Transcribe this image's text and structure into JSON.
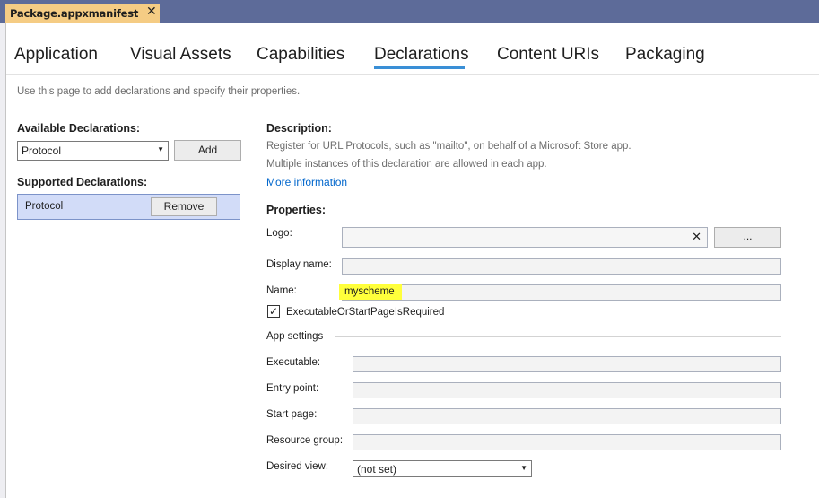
{
  "document_tab": {
    "title": "Package.appxmanifest",
    "pin_glyph": "⊸",
    "close_glyph": "✕"
  },
  "tabs": [
    {
      "label": "Application"
    },
    {
      "label": "Visual Assets"
    },
    {
      "label": "Capabilities"
    },
    {
      "label": "Declarations",
      "selected": true
    },
    {
      "label": "Content URIs"
    },
    {
      "label": "Packaging"
    }
  ],
  "intro": "Use this page to add declarations and specify their properties.",
  "left": {
    "available_heading": "Available Declarations:",
    "available_selected": "Protocol",
    "add_label": "Add",
    "supported_heading": "Supported Declarations:",
    "supported_items": [
      {
        "label": "Protocol",
        "remove_label": "Remove"
      }
    ]
  },
  "description": {
    "heading": "Description:",
    "line1": "Register for URL Protocols, such as \"mailto\", on behalf of a Microsoft Store app.",
    "line2": "Multiple instances of this declaration are allowed in each app.",
    "more_info": "More information"
  },
  "properties": {
    "heading": "Properties:",
    "logo_label": "Logo:",
    "logo_value": "",
    "logo_clear_glyph": "✕",
    "browse_label": "...",
    "display_name_label": "Display name:",
    "display_name_value": "",
    "name_label": "Name:",
    "name_value": "myscheme",
    "checkbox_label": "ExecutableOrStartPageIsRequired",
    "checkbox_checked": true,
    "checkbox_glyph": "✓"
  },
  "app_settings": {
    "heading": "App settings",
    "executable_label": "Executable:",
    "executable_value": "",
    "entry_point_label": "Entry point:",
    "entry_point_value": "",
    "start_page_label": "Start page:",
    "start_page_value": "",
    "resource_group_label": "Resource group:",
    "resource_group_value": "",
    "desired_view_label": "Desired view:",
    "desired_view_value": "(not set)"
  },
  "colors": {
    "tabstrip": "#5d6b99",
    "active_doc_tab": "#f5cc84",
    "selected_tab_underline": "#3a8fd6",
    "link": "#0066cc",
    "highlight": "#ffff3b",
    "selected_list_item": "#d2dcf8"
  }
}
